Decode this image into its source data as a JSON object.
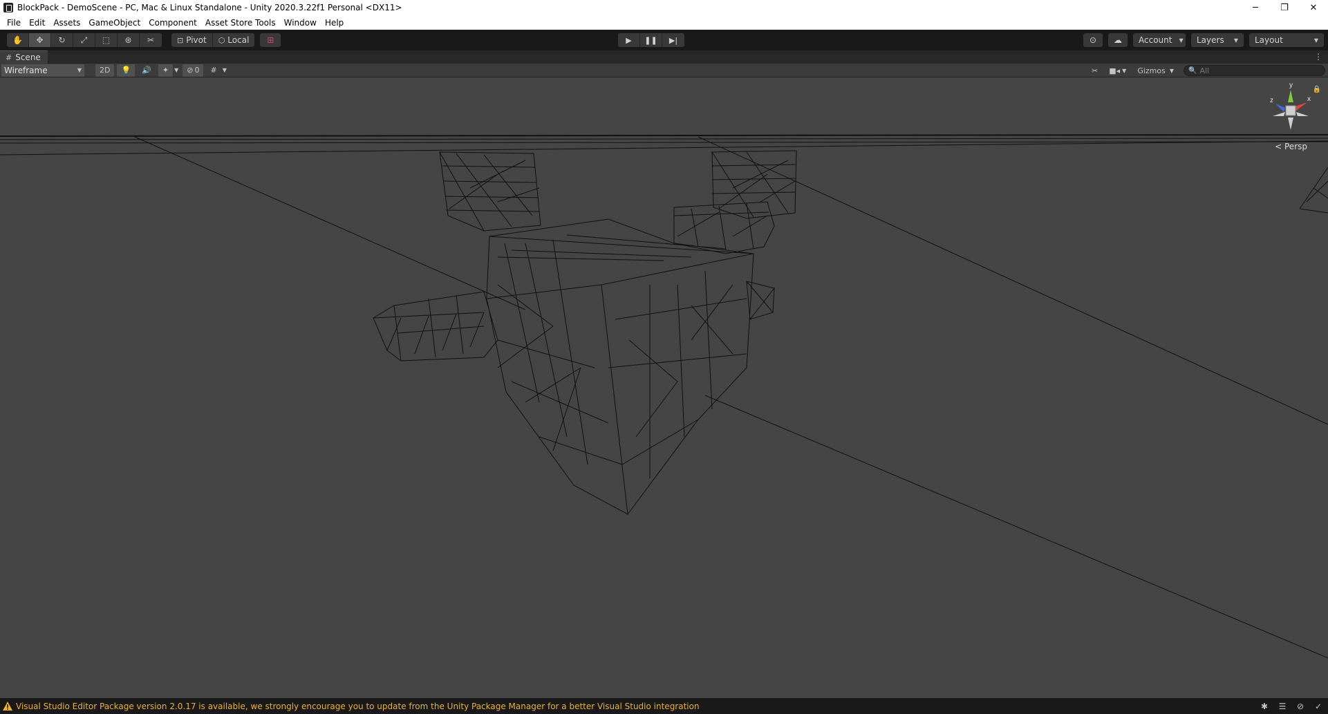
{
  "window": {
    "title": "BlockPack - DemoScene - PC, Mac & Linux Standalone - Unity 2020.3.22f1 Personal <DX11>",
    "controls": [
      "─",
      "❐",
      "✕"
    ]
  },
  "menu": [
    "File",
    "Edit",
    "Assets",
    "GameObject",
    "Component",
    "Asset Store Tools",
    "Window",
    "Help"
  ],
  "toolbar": {
    "tools": [
      {
        "name": "hand-tool",
        "icon": "✋"
      },
      {
        "name": "move-tool",
        "icon": "✥"
      },
      {
        "name": "rotate-tool",
        "icon": "↻"
      },
      {
        "name": "scale-tool",
        "icon": "⤢"
      },
      {
        "name": "rect-tool",
        "icon": "⬚"
      },
      {
        "name": "transform-tool",
        "icon": "⊛"
      },
      {
        "name": "custom-tool",
        "icon": "✂"
      }
    ],
    "pivot_label": "Pivot",
    "local_label": "Local",
    "play_icons": [
      "▶",
      "❚❚",
      "▶|"
    ],
    "account_label": "Account",
    "layers_label": "Layers",
    "layout_label": "Layout"
  },
  "scene_tab": {
    "label": "Scene"
  },
  "scene_toolbar": {
    "draw_mode": "Wireframe",
    "mode_2d": "2D",
    "hidden_count": "0",
    "gizmos_label": "Gizmos",
    "search_placeholder": "All"
  },
  "viewport": {
    "projection_label": "Persp",
    "axis_labels": {
      "y": "y",
      "x": "x",
      "z": "z"
    }
  },
  "status": {
    "message": "Visual Studio Editor Package version 2.0.17 is available, we strongly encourage you to update from the Unity Package Manager for a better Visual Studio integration",
    "colors": {
      "warning": "#e8b12e"
    }
  }
}
